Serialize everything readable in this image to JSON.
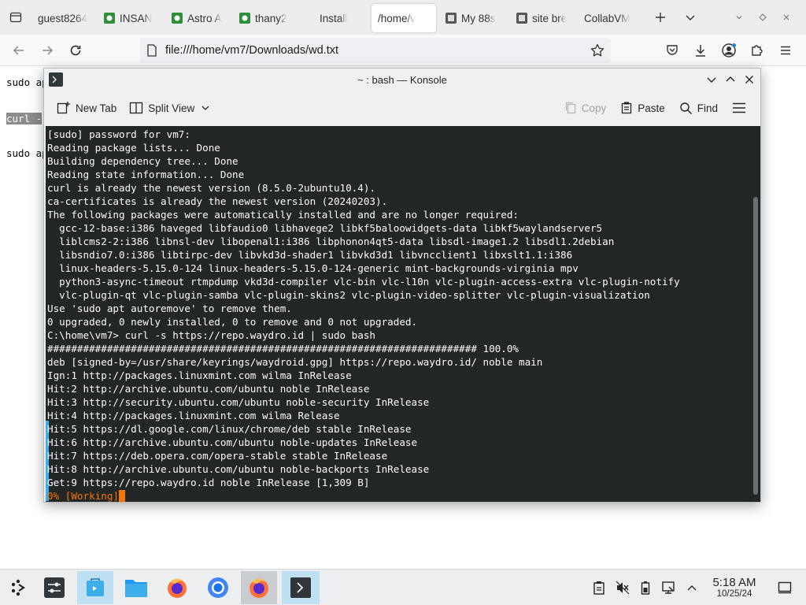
{
  "browser": {
    "tabs": [
      {
        "label": "guest8264",
        "favicon": "none"
      },
      {
        "label": "INSAN",
        "favicon": "green-square-icon"
      },
      {
        "label": "Astro A",
        "favicon": "green-square-icon"
      },
      {
        "label": "thany2",
        "favicon": "green-square-icon"
      },
      {
        "label": "Install",
        "favicon": "none"
      },
      {
        "label": "/home/v",
        "favicon": "none",
        "active": true
      },
      {
        "label": "My 88s",
        "favicon": "gray-square-icon"
      },
      {
        "label": "site bre",
        "favicon": "gray-square-icon"
      },
      {
        "label": "CollabVM",
        "favicon": "none"
      }
    ],
    "url": "file:///home/vm7/Downloads/wd.txt"
  },
  "page": {
    "lines": [
      "sudo ap",
      "curl -",
      "sudo ap"
    ]
  },
  "konsole": {
    "title": "~ : bash — Konsole",
    "toolbar": {
      "new_tab": "New Tab",
      "split_view": "Split View",
      "copy": "Copy",
      "paste": "Paste",
      "find": "Find"
    },
    "terminal_lines": [
      "[sudo] password for vm7:",
      "Reading package lists... Done",
      "Building dependency tree... Done",
      "Reading state information... Done",
      "curl is already the newest version (8.5.0-2ubuntu10.4).",
      "ca-certificates is already the newest version (20240203).",
      "The following packages were automatically installed and are no longer required:",
      "  gcc-12-base:i386 haveged libfaudio0 libhavege2 libkf5baloowidgets-data libkf5waylandserver5",
      "  liblcms2-2:i386 libnsl-dev libopenal1:i386 libphonon4qt5-data libsdl-image1.2 libsdl1.2debian",
      "  libsndio7.0:i386 libtirpc-dev libvkd3d-shader1 libvkd3d1 libvncclient1 libxslt1.1:i386",
      "  linux-headers-5.15.0-124 linux-headers-5.15.0-124-generic mint-backgrounds-virginia mpv",
      "  python3-async-timeout rtmpdump vkd3d-compiler vlc-bin vlc-l10n vlc-plugin-access-extra vlc-plugin-notify",
      "  vlc-plugin-qt vlc-plugin-samba vlc-plugin-skins2 vlc-plugin-video-splitter vlc-plugin-visualization",
      "Use 'sudo apt autoremove' to remove them.",
      "0 upgraded, 0 newly installed, 0 to remove and 0 not upgraded.",
      "C:\\home\\vm7> curl -s https://repo.waydro.id | sudo bash",
      "######################################################################## 100.0%",
      "deb [signed-by=/usr/share/keyrings/waydroid.gpg] https://repo.waydro.id/ noble main",
      "Ign:1 http://packages.linuxmint.com wilma InRelease",
      "Hit:2 http://archive.ubuntu.com/ubuntu noble InRelease",
      "Hit:3 http://security.ubuntu.com/ubuntu noble-security InRelease",
      "Hit:4 http://packages.linuxmint.com wilma Release",
      "Hit:5 https://dl.google.com/linux/chrome/deb stable InRelease",
      "Hit:6 http://archive.ubuntu.com/ubuntu noble-updates InRelease",
      "Hit:7 https://deb.opera.com/opera-stable stable InRelease",
      "Hit:8 http://archive.ubuntu.com/ubuntu noble-backports InRelease",
      "Get:9 https://repo.waydro.id noble InRelease [1,309 B]"
    ],
    "working_line": "0% [Working]"
  },
  "taskbar": {
    "time": "5:18 AM",
    "date": "10/25/24"
  },
  "colors": {
    "terminal_bg": "#232627",
    "terminal_fg": "#fcfcfc",
    "working": "#f67400",
    "accent": "#3daee9"
  }
}
